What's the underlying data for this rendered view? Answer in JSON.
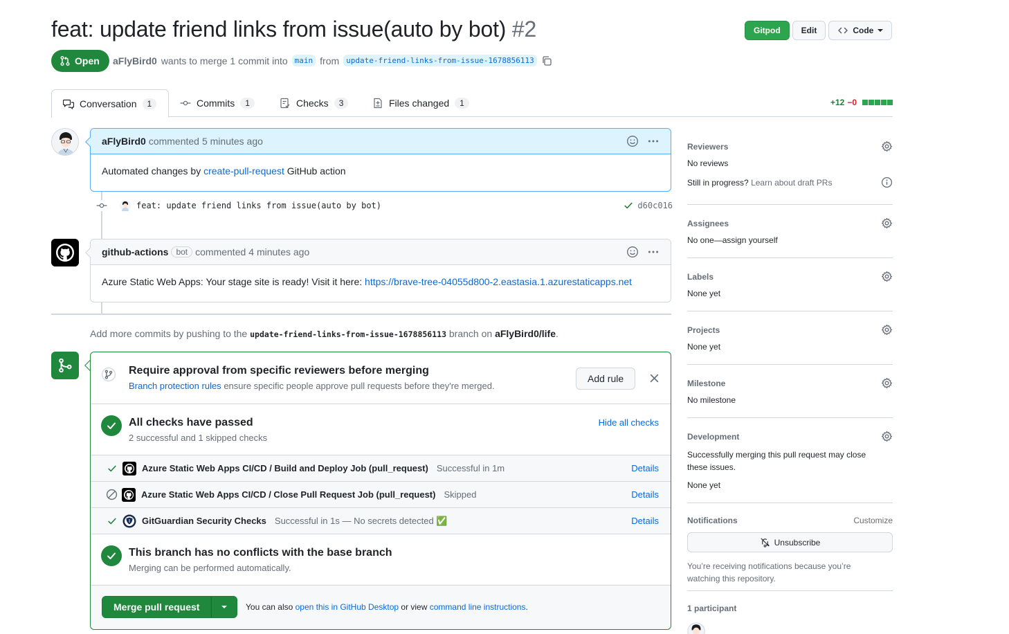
{
  "header": {
    "title": "feat: update friend links from issue(auto by bot)",
    "number": "#2",
    "gitpod_label": "Gitpod",
    "edit_label": "Edit",
    "code_label": "Code",
    "state": "Open",
    "author": "aFlyBird0",
    "merge_text": "wants to merge 1 commit into",
    "base_branch": "main",
    "from_text": "from",
    "head_branch": "update-friend-links-from-issue-1678856113"
  },
  "tabs": [
    {
      "label": "Conversation",
      "count": "1"
    },
    {
      "label": "Commits",
      "count": "1"
    },
    {
      "label": "Checks",
      "count": "3"
    },
    {
      "label": "Files changed",
      "count": "1"
    }
  ],
  "diffstat": {
    "additions": "+12",
    "deletions": "−0"
  },
  "timeline": {
    "comment1": {
      "author": "aFlyBird0",
      "action": "commented",
      "time": "5 minutes ago",
      "body_pre": "Automated changes by",
      "body_link": "create-pull-request",
      "body_post": "GitHub action"
    },
    "commit": {
      "message": "feat: update friend links from issue(auto by bot)",
      "sha": "d60c016"
    },
    "comment2": {
      "author": "github-actions",
      "bot_label": "bot",
      "action": "commented",
      "time": "4 minutes ago",
      "body_pre": "Azure Static Web Apps: Your stage site is ready! Visit it here:",
      "body_link": "https://brave-tree-04055d800-2.eastasia.1.azurestaticapps.net"
    },
    "push_hint": {
      "pre": "Add more commits by pushing to the",
      "branch": "update-friend-links-from-issue-1678856113",
      "mid": "branch on",
      "repo": "aFlyBird0/life",
      "end": "."
    }
  },
  "mergebox": {
    "protection": {
      "title": "Require approval from specific reviewers before merging",
      "link": "Branch protection rules",
      "text": "ensure specific people approve pull requests before they're merged.",
      "add_rule": "Add rule"
    },
    "checks_summary": {
      "title": "All checks have passed",
      "subtitle": "2 successful and 1 skipped checks",
      "toggle": "Hide all checks"
    },
    "checks": [
      {
        "name": "Azure Static Web Apps CI/CD / Build and Deploy Job (pull_request)",
        "status": "Successful in 1m",
        "details": "Details",
        "state": "success"
      },
      {
        "name": "Azure Static Web Apps CI/CD / Close Pull Request Job (pull_request)",
        "status": "Skipped",
        "details": "Details",
        "state": "skipped"
      },
      {
        "name": "GitGuardian Security Checks",
        "status": "Successful in 1s — No secrets detected ✅",
        "details": "Details",
        "state": "success"
      }
    ],
    "conflicts": {
      "title": "This branch has no conflicts with the base branch",
      "subtitle": "Merging can be performed automatically."
    },
    "merge_button": "Merge pull request",
    "also_pre": "You can also",
    "also_link1": "open this in GitHub Desktop",
    "also_mid": "or view",
    "also_link2": "command line instructions",
    "also_end": "."
  },
  "sidebar": {
    "reviewers": {
      "title": "Reviewers",
      "value": "No reviews",
      "progress_pre": "Still in progress?",
      "progress_link": "Learn about draft PRs"
    },
    "assignees": {
      "title": "Assignees",
      "value": "No one—assign yourself"
    },
    "labels": {
      "title": "Labels",
      "value": "None yet"
    },
    "projects": {
      "title": "Projects",
      "value": "None yet"
    },
    "milestone": {
      "title": "Milestone",
      "value": "No milestone"
    },
    "development": {
      "title": "Development",
      "text": "Successfully merging this pull request may close these issues.",
      "value": "None yet"
    },
    "notifications": {
      "title": "Notifications",
      "customize": "Customize",
      "button": "Unsubscribe",
      "text": "You’re receiving notifications because you’re watching this repository."
    },
    "participants": {
      "title": "1 participant"
    }
  },
  "colors": {
    "green": "#1f883d",
    "link": "#0969da",
    "border": "#d0d7de",
    "highlight": "#ddf4ff"
  }
}
